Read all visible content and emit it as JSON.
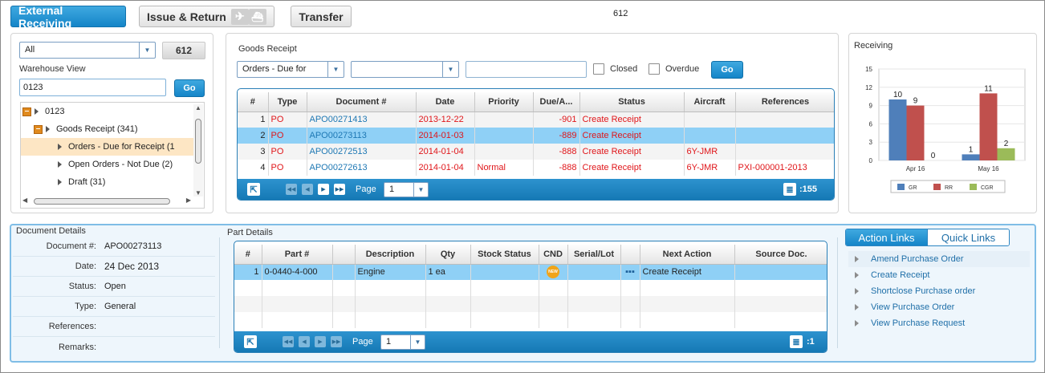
{
  "top_tabs": {
    "external_receiving": "External Receiving",
    "issue_return": "Issue & Return",
    "transfer": "Transfer"
  },
  "top_count": "612",
  "warehouse": {
    "filter_value": "All",
    "count": "612",
    "label": "Warehouse View",
    "search_value": "0123",
    "go_label": "Go",
    "tree": [
      {
        "label": "0123",
        "level": 0
      },
      {
        "label": "Goods Receipt (341)",
        "level": 1
      },
      {
        "label": "Orders - Due for Receipt (1",
        "level": 2,
        "selected": true
      },
      {
        "label": "Open Orders - Not Due (2)",
        "level": 2
      },
      {
        "label": "Draft (31)",
        "level": 2
      }
    ]
  },
  "goods_receipt": {
    "title": "Goods Receipt",
    "filter1": "Orders - Due for",
    "filter2": "",
    "search_value": "",
    "closed_label": "Closed",
    "overdue_label": "Overdue",
    "go_label": "Go",
    "columns": [
      "#",
      "Type",
      "Document #",
      "Date",
      "Priority",
      "Due/A...",
      "Status",
      "Aircraft",
      "References"
    ],
    "rows": [
      {
        "n": "1",
        "type": "PO",
        "doc": "APO00271413",
        "date": "2013-12-22",
        "priority": "",
        "due": "-901",
        "status": "Create Receipt",
        "aircraft": "",
        "ref": ""
      },
      {
        "n": "2",
        "type": "PO",
        "doc": "APO00273113",
        "date": "2014-01-03",
        "priority": "",
        "due": "-889",
        "status": "Create Receipt",
        "aircraft": "",
        "ref": ""
      },
      {
        "n": "3",
        "type": "PO",
        "doc": "APO00272513",
        "date": "2014-01-04",
        "priority": "",
        "due": "-888",
        "status": "Create Receipt",
        "aircraft": "6Y-JMR",
        "ref": ""
      },
      {
        "n": "4",
        "type": "PO",
        "doc": "APO00272613",
        "date": "2014-01-04",
        "priority": "Normal",
        "due": "-888",
        "status": "Create Receipt",
        "aircraft": "6Y-JMR",
        "ref": "PXI-000001-2013"
      }
    ],
    "page_label": "Page",
    "page_value": "1",
    "total": ":155"
  },
  "receiving_chart": {
    "title": "Receiving"
  },
  "chart_data": {
    "type": "bar",
    "title": "Receiving",
    "categories": [
      "Apr 16",
      "May 16"
    ],
    "series": [
      {
        "name": "GR",
        "values": [
          10,
          1
        ],
        "color": "#4f7fba"
      },
      {
        "name": "RR",
        "values": [
          9,
          11
        ],
        "color": "#c0504d"
      },
      {
        "name": "CGR",
        "values": [
          0,
          2
        ],
        "color": "#9bbb59"
      }
    ],
    "yticks": [
      "0",
      "3",
      "6",
      "9",
      "12",
      "15"
    ],
    "ylim": [
      0,
      15
    ],
    "legend_placement": "bottom"
  },
  "document_details": {
    "title": "Document Details",
    "fields": [
      {
        "key": "Document #:",
        "value": "APO00273113"
      },
      {
        "key": "Date:",
        "value": "24 Dec 2013"
      },
      {
        "key": "Status:",
        "value": "Open"
      },
      {
        "key": "Type:",
        "value": "General"
      },
      {
        "key": "References:",
        "value": ""
      },
      {
        "key": "Remarks:",
        "value": ""
      }
    ]
  },
  "part_details": {
    "title": "Part Details",
    "columns": [
      "#",
      "Part #",
      "",
      "Description",
      "Qty",
      "Stock Status",
      "CND",
      "Serial/Lot",
      "",
      "Next Action",
      "Source Doc."
    ],
    "rows": [
      {
        "n": "1",
        "part": "0-0440-4-000",
        "desc": "Engine",
        "qty": "1 ea",
        "stock": "",
        "cnd": "NEW",
        "serial": "",
        "next": "Create Receipt",
        "source": ""
      }
    ],
    "page_label": "Page",
    "page_value": "1",
    "total": ":1"
  },
  "links": {
    "tab_action": "Action Links",
    "tab_quick": "Quick Links",
    "items": [
      "Amend Purchase Order",
      "Create Receipt",
      "Shortclose Purchase order",
      "View Purchase Order",
      "View Purchase Request"
    ]
  }
}
